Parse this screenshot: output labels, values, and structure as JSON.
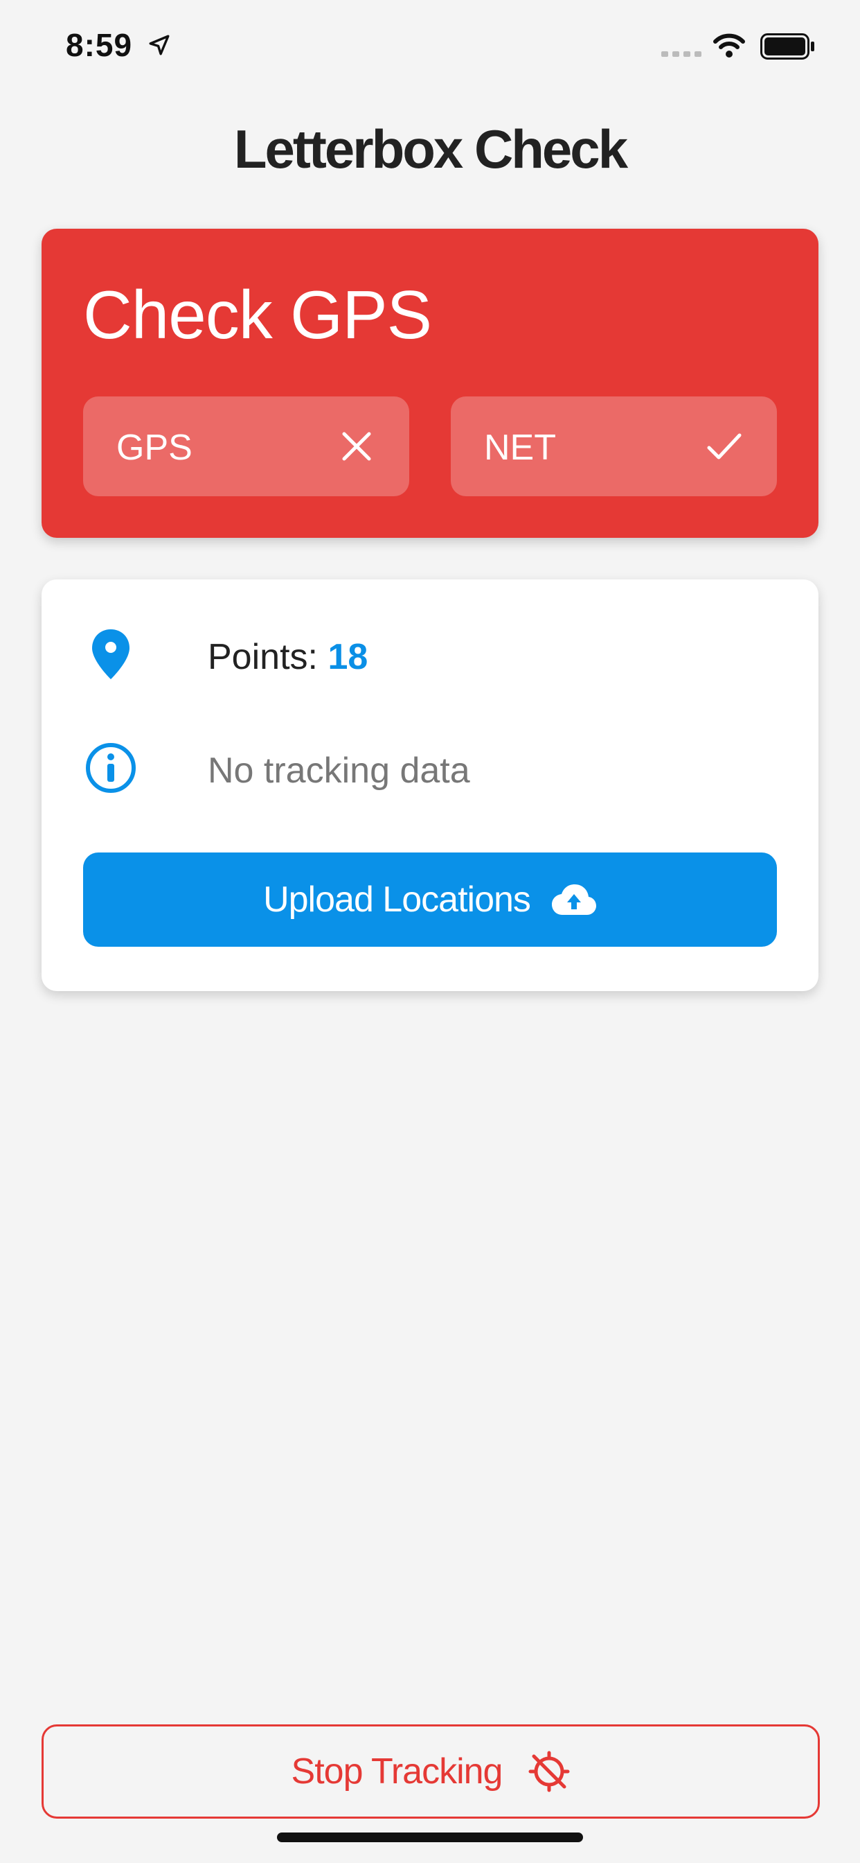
{
  "status_bar": {
    "time": "8:59",
    "icons": [
      "location-arrow-icon",
      "cellular-signal-icon",
      "wifi-icon",
      "battery-icon"
    ]
  },
  "header": {
    "title": "Letterbox Check"
  },
  "status_card": {
    "heading": "Check GPS",
    "background_color": "#e53935",
    "chips": [
      {
        "label": "GPS",
        "state_icon": "close-icon",
        "ok": false
      },
      {
        "label": "NET",
        "state_icon": "check-icon",
        "ok": true
      }
    ]
  },
  "info_card": {
    "points_label": "Points:",
    "points_value": "18",
    "points_icon": "map-pin-icon",
    "tracking_text": "No tracking data",
    "tracking_icon": "info-icon",
    "upload_button_label": "Upload Locations",
    "upload_icon": "cloud-upload-icon",
    "accent_color": "#0a91e8"
  },
  "footer": {
    "stop_button_label": "Stop Tracking",
    "stop_icon": "location-off-icon",
    "danger_color": "#e53935"
  }
}
